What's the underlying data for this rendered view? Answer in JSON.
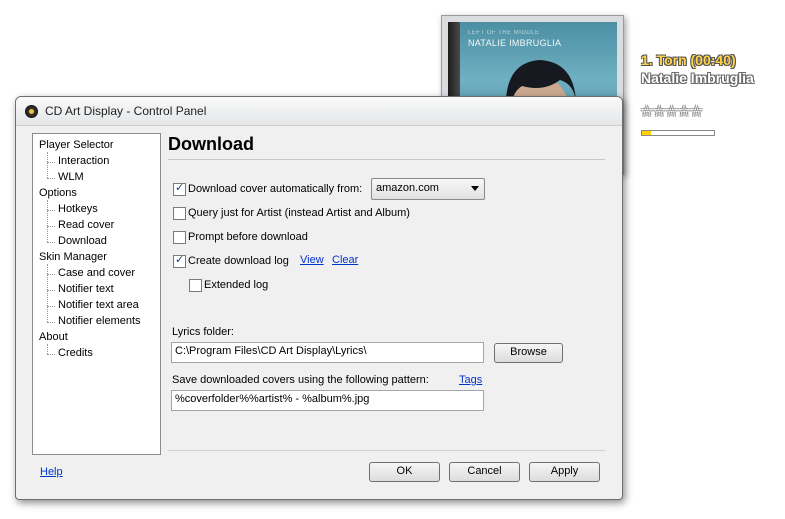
{
  "window": {
    "title": "CD Art Display - Control Panel"
  },
  "tree": [
    {
      "label": "Player Selector",
      "level": 0
    },
    {
      "label": "Interaction",
      "level": 1
    },
    {
      "label": "WLM",
      "level": 1
    },
    {
      "label": "Options",
      "level": 0
    },
    {
      "label": "Hotkeys",
      "level": 1
    },
    {
      "label": "Read cover",
      "level": 1
    },
    {
      "label": "Download",
      "level": 1
    },
    {
      "label": "Skin Manager",
      "level": 0
    },
    {
      "label": "Case and cover",
      "level": 1
    },
    {
      "label": "Notifier text",
      "level": 1
    },
    {
      "label": "Notifier text area",
      "level": 1
    },
    {
      "label": "Notifier elements",
      "level": 1
    },
    {
      "label": "About",
      "level": 0
    },
    {
      "label": "Credits",
      "level": 1
    }
  ],
  "page": {
    "heading": "Download",
    "options": [
      {
        "label": "Download cover automatically from:",
        "checked": true
      },
      {
        "label": "Query just for Artist (instead Artist and Album)",
        "checked": false
      },
      {
        "label": "Prompt before download",
        "checked": false
      },
      {
        "label": "Create download log",
        "checked": true
      },
      {
        "label": "Extended log",
        "checked": false
      }
    ],
    "source_select": {
      "value": "amazon.com"
    },
    "log_links": {
      "view": "View",
      "clear": "Clear"
    },
    "lyrics": {
      "label": "Lyrics folder:",
      "value": "C:\\Program Files\\CD Art Display\\Lyrics\\",
      "browse": "Browse"
    },
    "pattern": {
      "label": "Save downloaded covers using the following pattern:",
      "tags": "Tags",
      "value": "%coverfolder%%artist% - %album%.jpg"
    }
  },
  "footer": {
    "help": "Help",
    "ok": "OK",
    "cancel": "Cancel",
    "apply": "Apply"
  },
  "album": {
    "top_text": "LEFT OF THE MIDDLE",
    "artist_text": "NATALIE IMBRUGLIA"
  },
  "notifier": {
    "track": "1. Torn (00:40)",
    "artist": "Natalie Imbruglia",
    "rating": 0,
    "rating_max": 5,
    "star_glyph": "☆",
    "progress": 0.12
  }
}
